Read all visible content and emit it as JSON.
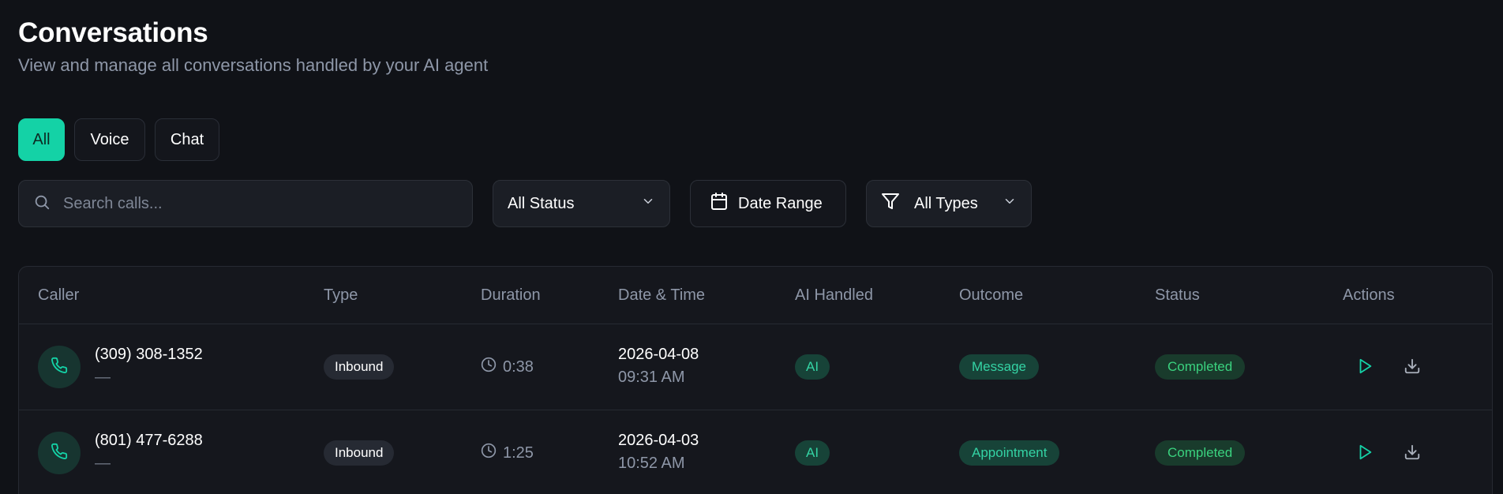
{
  "header": {
    "title": "Conversations",
    "subtitle": "View and manage all conversations handled by your AI agent"
  },
  "tabs": [
    {
      "label": "All",
      "active": true
    },
    {
      "label": "Voice",
      "active": false
    },
    {
      "label": "Chat",
      "active": false
    }
  ],
  "filters": {
    "search_placeholder": "Search calls...",
    "status_label": "All Status",
    "date_label": "Date Range",
    "types_label": "All Types"
  },
  "table": {
    "columns": [
      "Caller",
      "Type",
      "Duration",
      "Date & Time",
      "AI Handled",
      "Outcome",
      "Status",
      "Actions"
    ],
    "rows": [
      {
        "caller": "(309) 308-1352",
        "caller_sub": "—",
        "type": "Inbound",
        "duration": "0:38",
        "date": "2026-04-08",
        "time": "09:31 AM",
        "ai": "AI",
        "outcome": "Message",
        "status": "Completed"
      },
      {
        "caller": "(801) 477-6288",
        "caller_sub": "—",
        "type": "Inbound",
        "duration": "1:25",
        "date": "2026-04-03",
        "time": "10:52 AM",
        "ai": "AI",
        "outcome": "Appointment",
        "status": "Completed"
      }
    ]
  },
  "colors": {
    "background": "#101217",
    "accent": "#14d2a6",
    "status_green": "#3ad27f",
    "muted": "#8e97a8"
  },
  "icons": [
    "search-icon",
    "chevron-down-icon",
    "calendar-icon",
    "filter-icon",
    "phone-icon",
    "clock-icon",
    "play-icon",
    "download-icon"
  ]
}
